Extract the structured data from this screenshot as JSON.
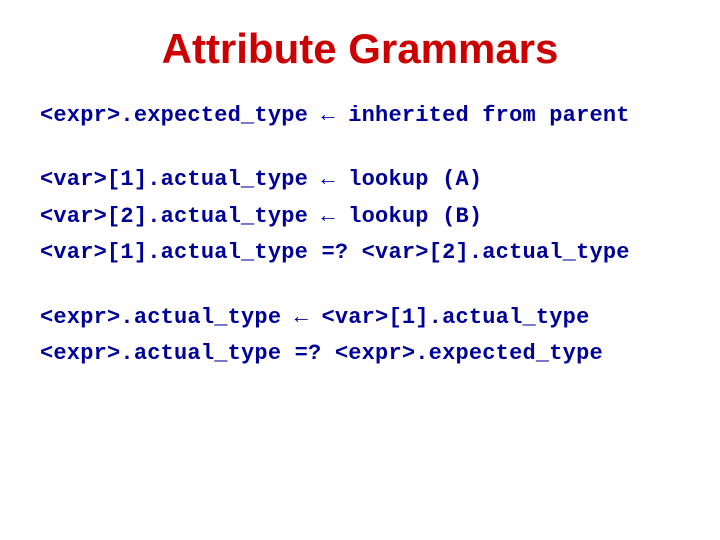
{
  "title": "Attribute Grammars",
  "lines": {
    "l1": "<expr>.expected_type ← inherited from parent",
    "l2": "<var>[1].actual_type ← lookup (A)",
    "l3": "<var>[2].actual_type ← lookup (B)",
    "l4": "<var>[1].actual_type =? <var>[2].actual_type",
    "l5": "<expr>.actual_type ← <var>[1].actual_type",
    "l6": "<expr>.actual_type =? <expr>.expected_type"
  }
}
